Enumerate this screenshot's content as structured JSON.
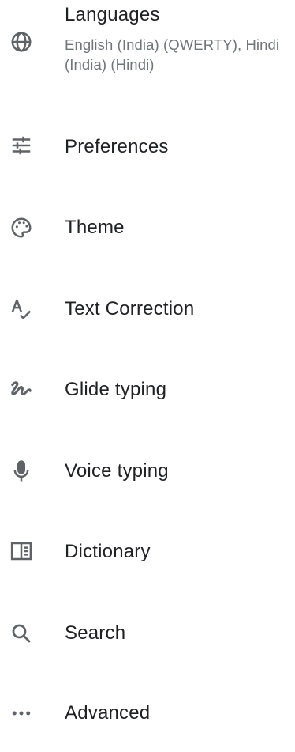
{
  "settings": {
    "items": [
      {
        "title": "Languages",
        "subtitle": "English (India) (QWERTY), Hindi (India) (Hindi)",
        "icon": "globe-icon"
      },
      {
        "title": "Preferences",
        "icon": "sliders-icon"
      },
      {
        "title": "Theme",
        "icon": "palette-icon"
      },
      {
        "title": "Text Correction",
        "icon": "spellcheck-icon"
      },
      {
        "title": "Glide typing",
        "icon": "gesture-icon"
      },
      {
        "title": "Voice typing",
        "icon": "microphone-icon"
      },
      {
        "title": "Dictionary",
        "icon": "book-icon"
      },
      {
        "title": "Search",
        "icon": "search-icon"
      },
      {
        "title": "Advanced",
        "icon": "more-horiz-icon"
      }
    ]
  }
}
